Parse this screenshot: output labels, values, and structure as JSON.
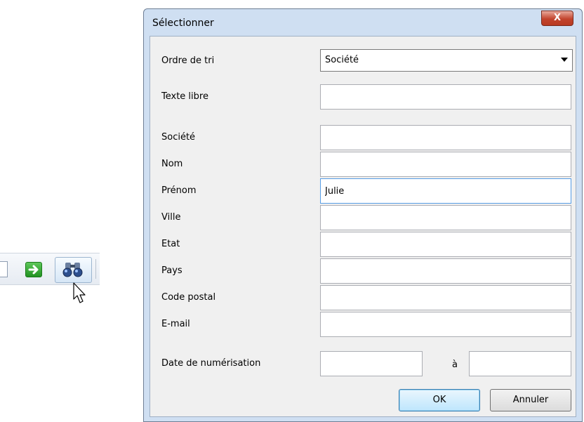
{
  "dialog": {
    "title": "Sélectionner",
    "close_label": "X",
    "sort": {
      "label": "Ordre de tri",
      "selected": "Société"
    },
    "free_text": {
      "label": "Texte libre",
      "value": ""
    },
    "fields": [
      {
        "label": "Société",
        "value": ""
      },
      {
        "label": "Nom",
        "value": ""
      },
      {
        "label": "Prénom",
        "value": "Julie"
      },
      {
        "label": "Ville",
        "value": ""
      },
      {
        "label": "Etat",
        "value": ""
      },
      {
        "label": "Pays",
        "value": ""
      },
      {
        "label": "Code postal",
        "value": ""
      },
      {
        "label": "E-mail",
        "value": ""
      }
    ],
    "scan_date": {
      "label": "Date de numérisation",
      "separator": "à",
      "from": "",
      "to": ""
    },
    "ok_label": "OK",
    "cancel_label": "Annuler"
  },
  "toolbar": {
    "icons": [
      "arrow-right-icon",
      "binoculars-icon",
      "mouse-cursor-icon"
    ]
  }
}
